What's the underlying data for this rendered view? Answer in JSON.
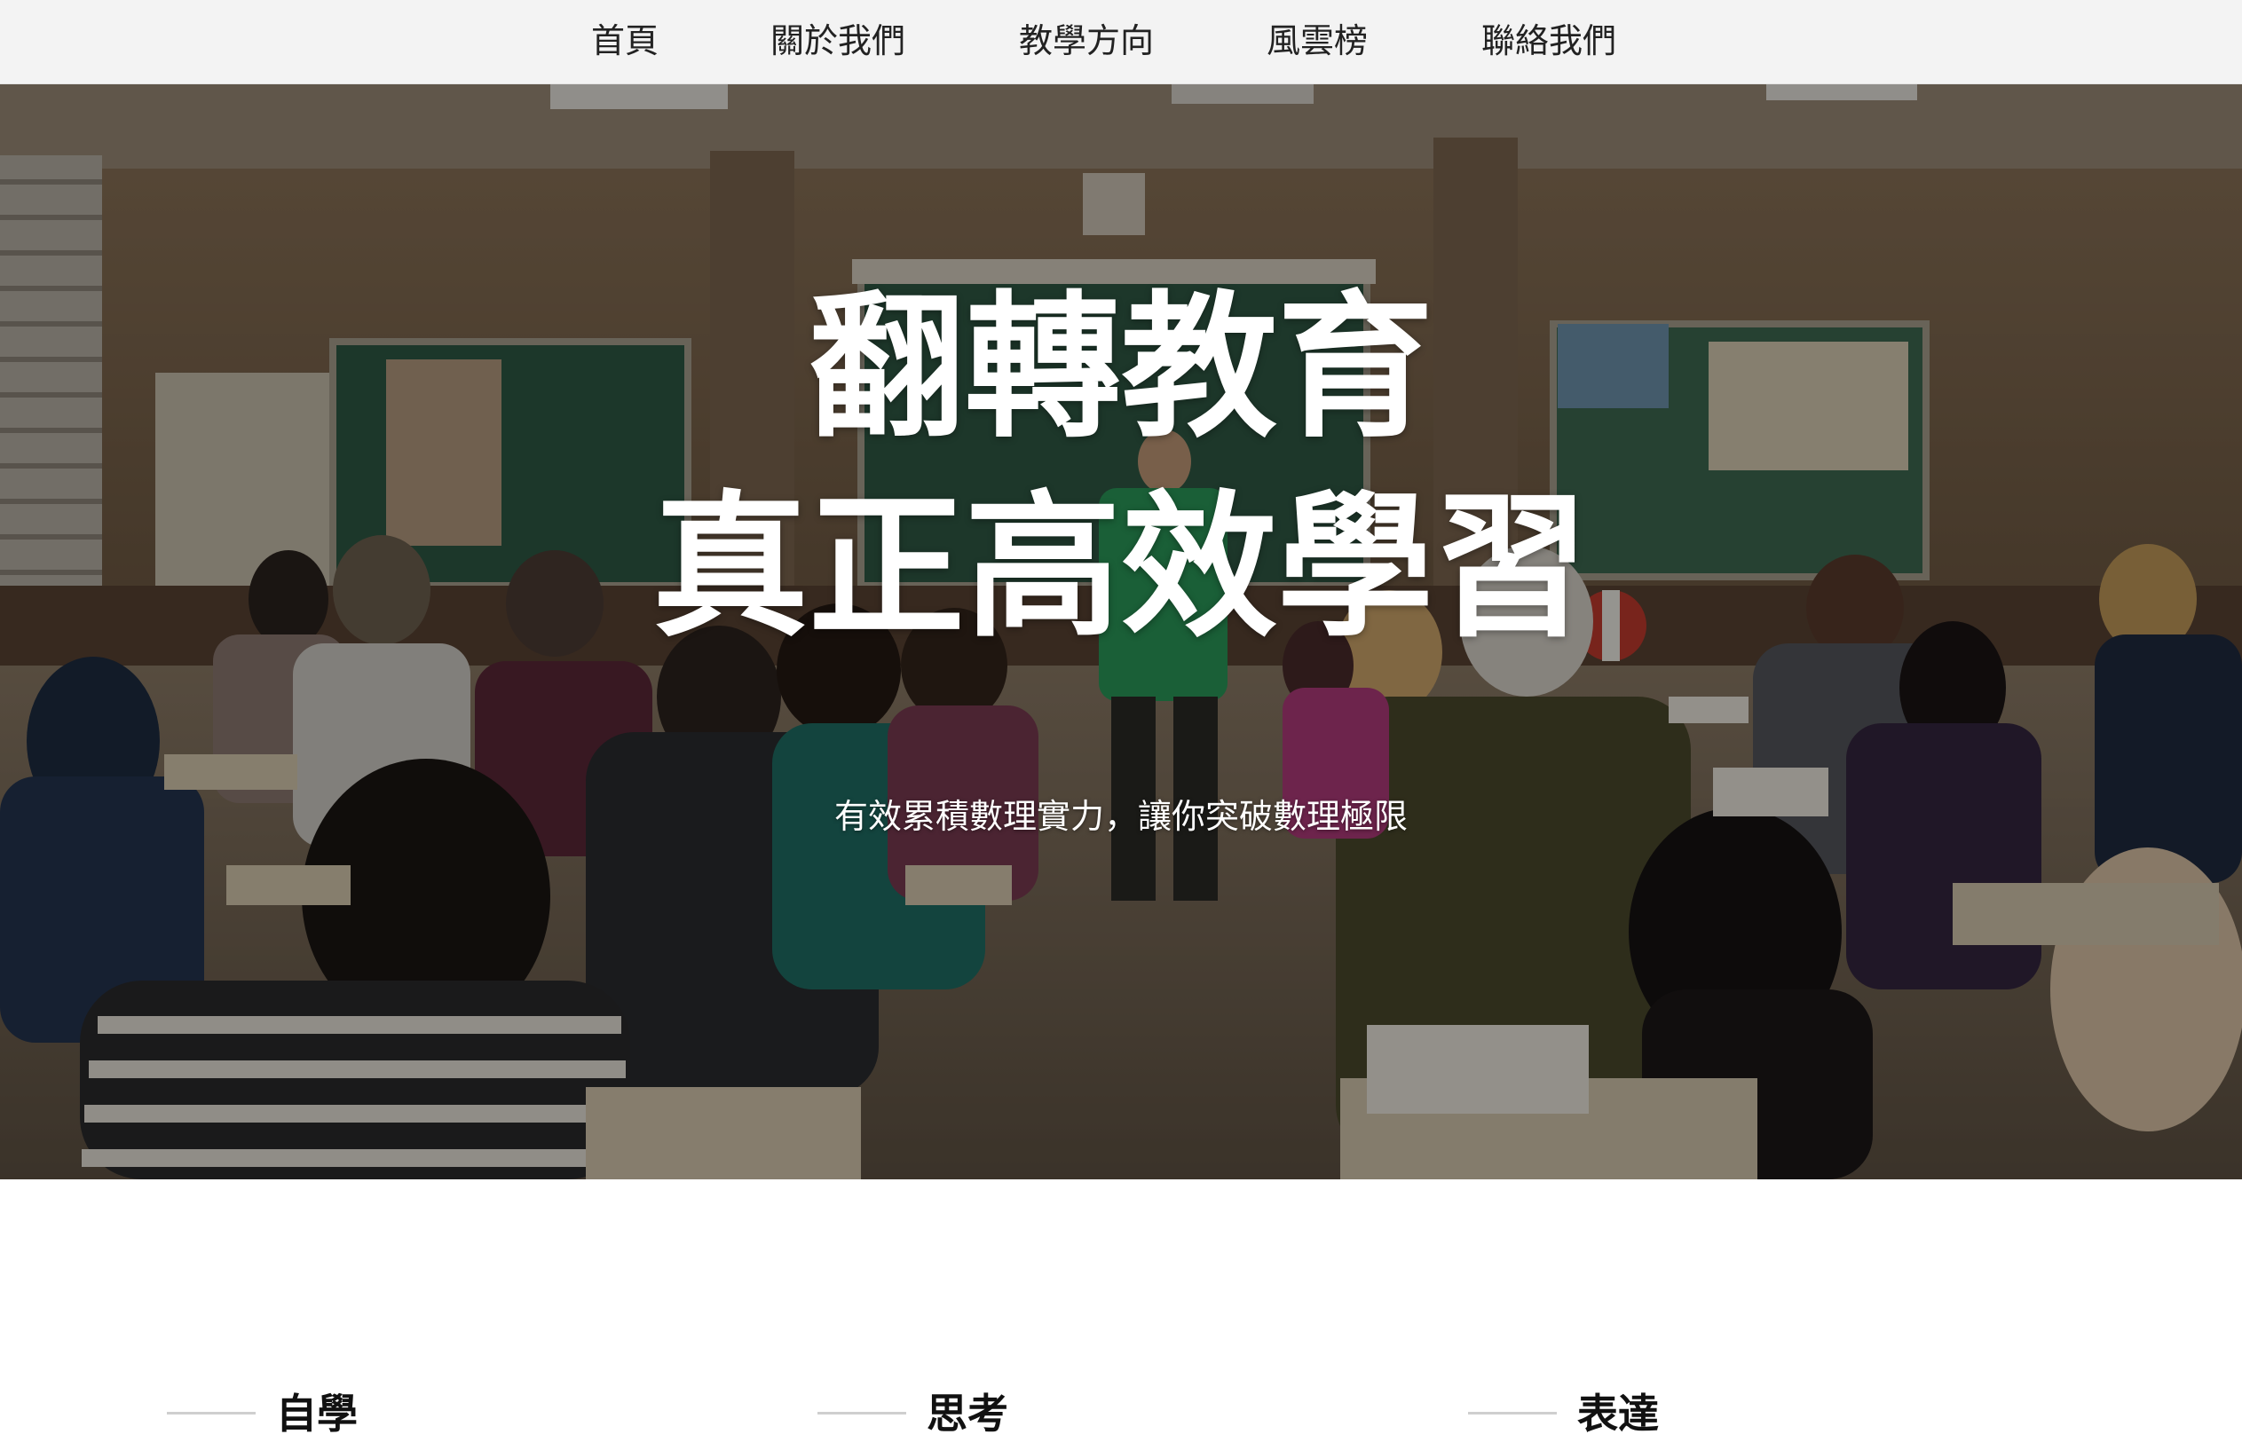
{
  "nav": {
    "items": [
      {
        "label": "首頁"
      },
      {
        "label": "關於我們"
      },
      {
        "label": "教學方向"
      },
      {
        "label": "風雲榜"
      },
      {
        "label": "聯絡我們"
      }
    ]
  },
  "hero": {
    "title_line1": "翻轉教育",
    "title_line2": "真正高效學習",
    "subtitle": "有效累積數理實力，讓你突破數理極限"
  },
  "features": [
    {
      "title": "自學"
    },
    {
      "title": "思考"
    },
    {
      "title": "表達"
    }
  ],
  "colors": {
    "nav_background": "#f3f3f3",
    "hero_text": "#ffffff",
    "feature_rule": "#cfcfcf"
  }
}
